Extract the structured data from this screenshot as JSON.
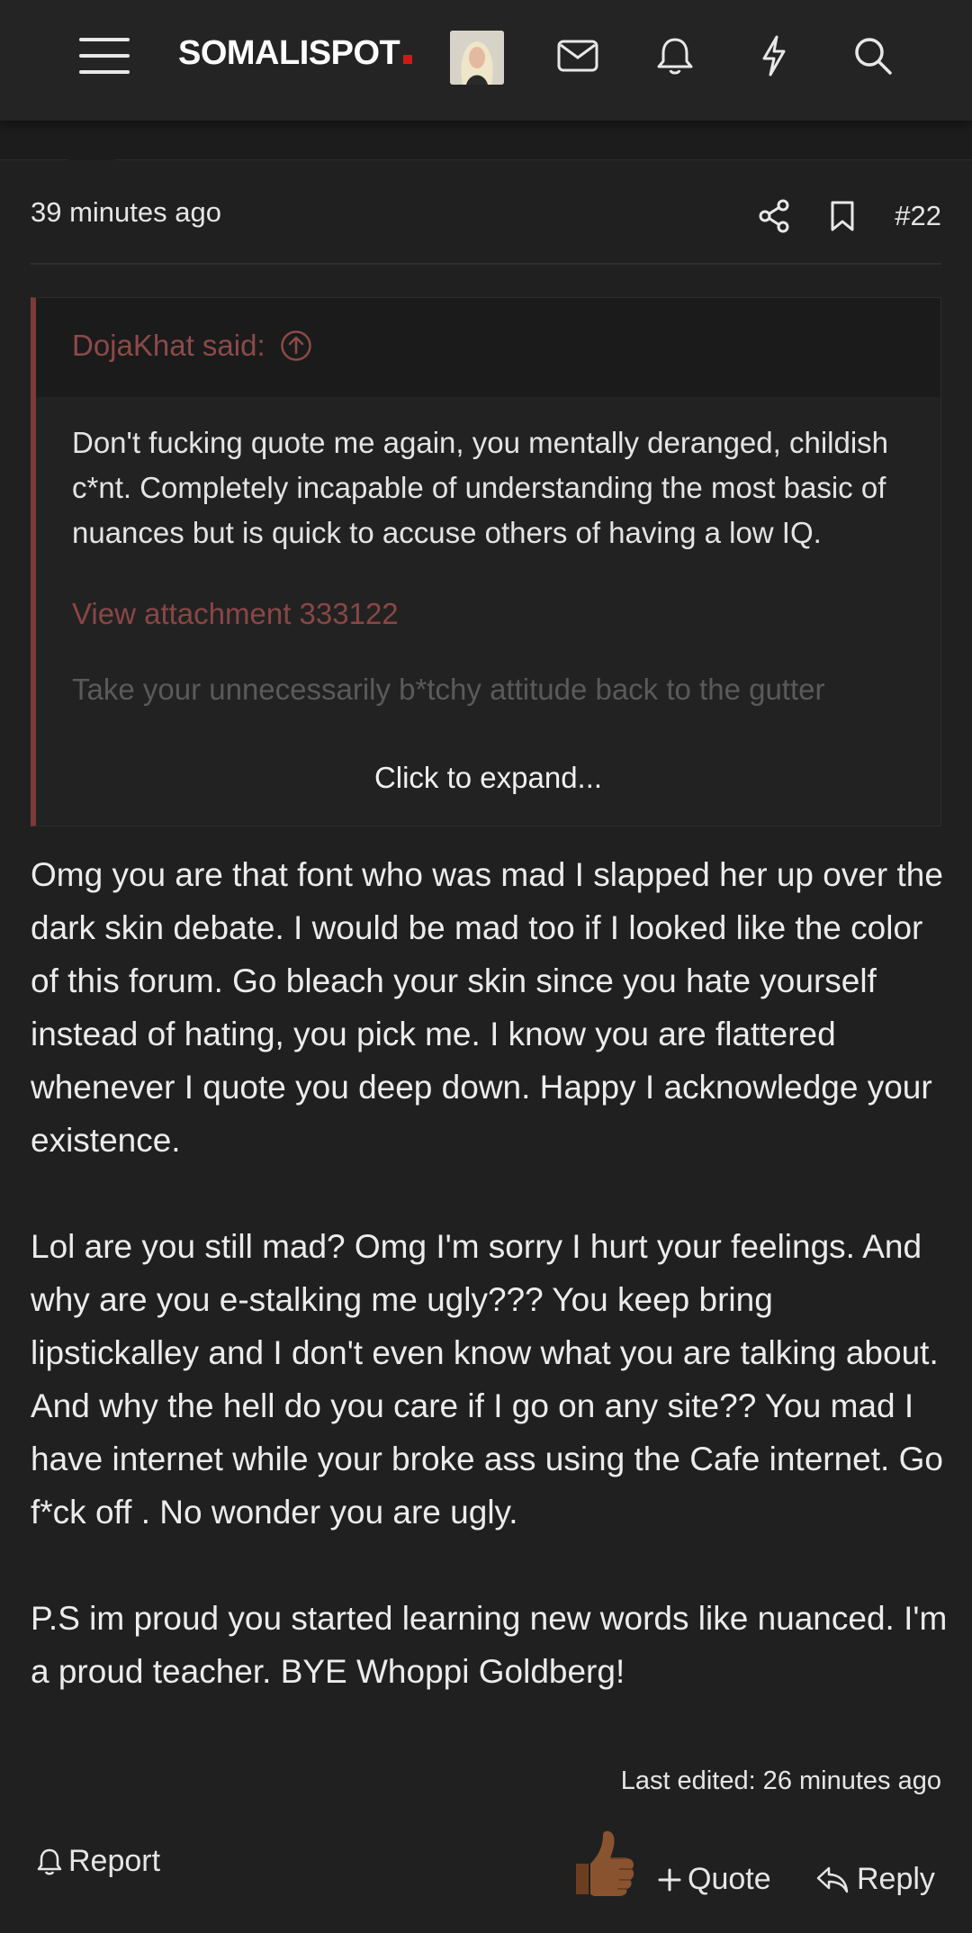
{
  "header": {
    "logo_text": "SOMALISPOT",
    "icons": [
      "menu-icon",
      "avatar",
      "mail-icon",
      "bell-icon",
      "bolt-icon",
      "search-icon"
    ]
  },
  "post": {
    "time": "39 minutes ago",
    "number": "#22",
    "quote": {
      "author": "DojaKhat said:",
      "text": "Don't fucking quote me again, you mentally deranged, childish c*nt. Completely incapable of understanding the most basic of nuances but is quick to accuse others of having a low IQ.",
      "attachment_link": "View attachment 333122",
      "faded_text": "Take your unnecessarily b*tchy attitude back to the gutter",
      "expand_label": "Click to expand..."
    },
    "paragraphs": [
      "Omg you are that font who was mad I slapped her up over the dark skin debate. I would be mad too if I looked like the color of this forum. Go bleach your skin since you hate yourself instead of hating, you pick me. I know you are flattered whenever I quote you deep down. Happy I acknowledge your existence.",
      "Lol are you still mad? Omg I'm sorry I hurt your feelings. And why are you e-stalking me ugly??? You keep bring lipstickalley and I don't even know what you are talking about. And why the hell do you care if I go on any site?? You mad I have internet while your broke ass using the Cafe internet. Go f*ck off . No wonder you are ugly.",
      "P.S im proud you started learning new words like nuanced. I'm a proud teacher. BYE Whoppi Goldberg!"
    ],
    "edited": "Last edited: 26 minutes ago"
  },
  "actions": {
    "report_label": "Report",
    "quote_label": "Quote",
    "reply_label": "Reply"
  },
  "colors": {
    "background": "#202020",
    "quote_accent": "#7c3a3a",
    "logo_dot": "#d01919",
    "link": "#8a4646"
  }
}
